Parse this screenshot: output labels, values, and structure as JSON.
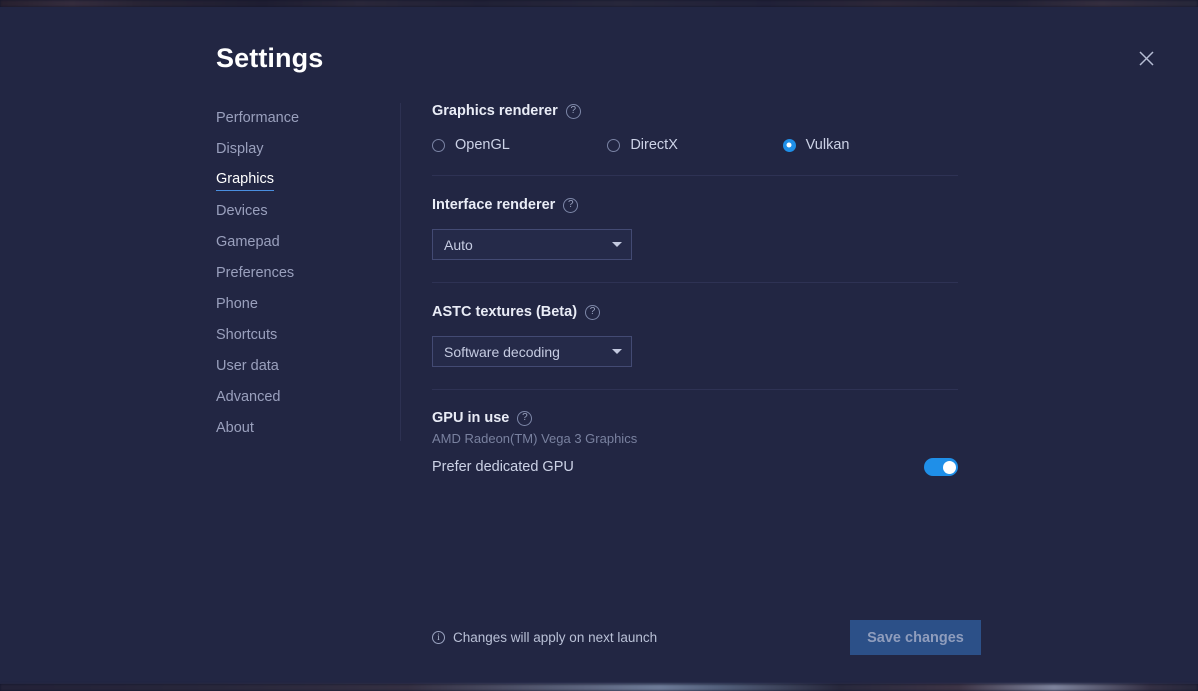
{
  "window": {
    "title": "Settings",
    "close_icon": "close-icon",
    "background_color": "#222643",
    "accent_color": "#1f8fe8"
  },
  "sidebar": {
    "items": [
      {
        "label": "Performance",
        "active": false
      },
      {
        "label": "Display",
        "active": false
      },
      {
        "label": "Graphics",
        "active": true
      },
      {
        "label": "Devices",
        "active": false
      },
      {
        "label": "Gamepad",
        "active": false
      },
      {
        "label": "Preferences",
        "active": false
      },
      {
        "label": "Phone",
        "active": false
      },
      {
        "label": "Shortcuts",
        "active": false
      },
      {
        "label": "User data",
        "active": false
      },
      {
        "label": "Advanced",
        "active": false
      },
      {
        "label": "About",
        "active": false
      }
    ]
  },
  "graphics_renderer": {
    "label": "Graphics renderer",
    "help_icon": "help-circle-icon",
    "options": [
      {
        "label": "OpenGL",
        "selected": false
      },
      {
        "label": "DirectX",
        "selected": false
      },
      {
        "label": "Vulkan",
        "selected": true
      }
    ]
  },
  "interface_renderer": {
    "label": "Interface renderer",
    "help_icon": "help-circle-icon",
    "value": "Auto",
    "caret_icon": "chevron-down-icon"
  },
  "astc_textures": {
    "label": "ASTC textures (Beta)",
    "help_icon": "help-circle-icon",
    "value": "Software decoding",
    "caret_icon": "chevron-down-icon"
  },
  "gpu_in_use": {
    "label": "GPU in use",
    "help_icon": "help-circle-icon",
    "device": "AMD Radeon(TM) Vega 3 Graphics",
    "prefer_dedicated_label": "Prefer dedicated GPU",
    "prefer_dedicated_on": true
  },
  "footer": {
    "note": "Changes will apply on next launch",
    "info_icon": "info-circle-icon",
    "save_label": "Save changes",
    "save_enabled": false
  }
}
